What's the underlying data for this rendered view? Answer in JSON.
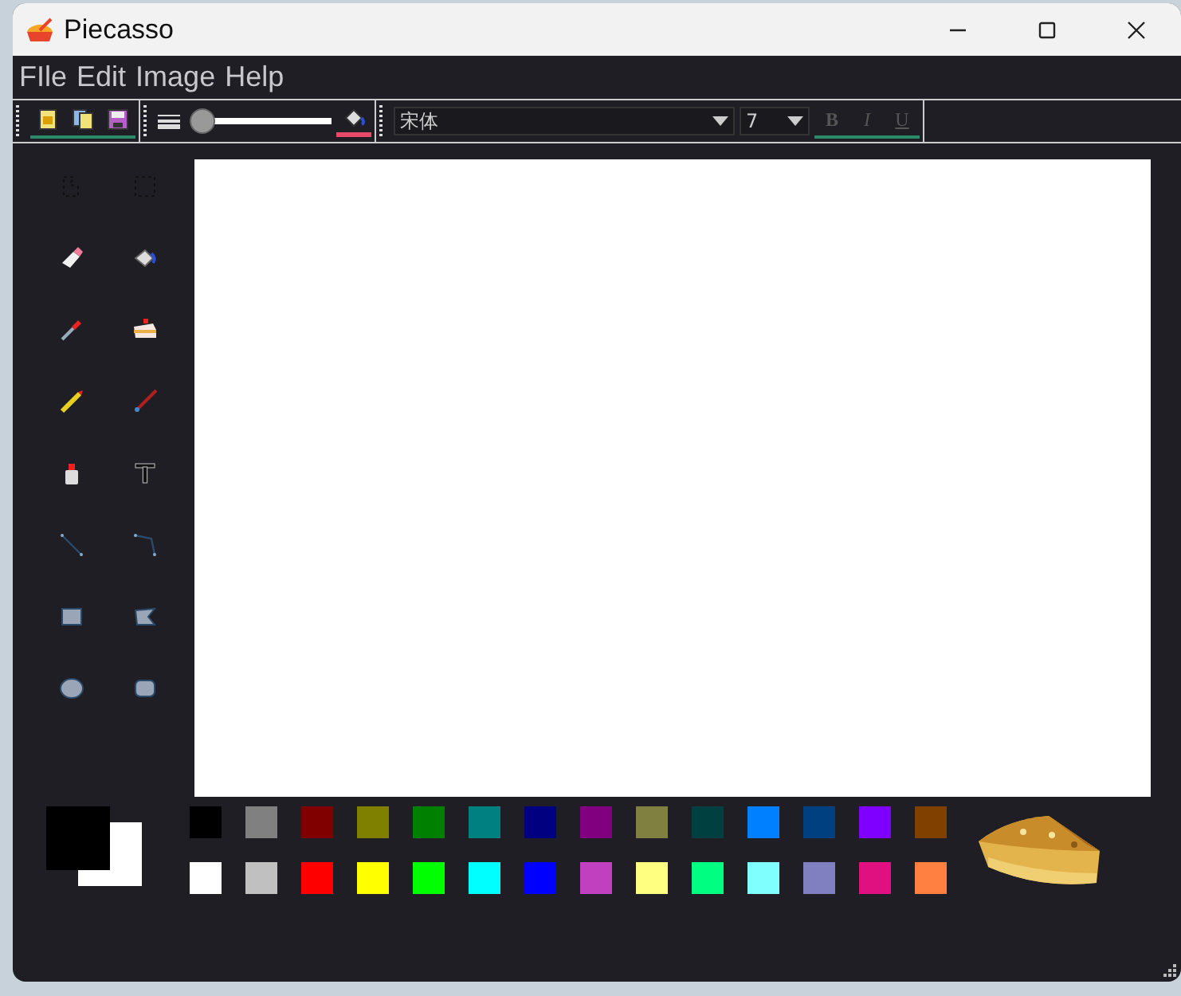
{
  "window": {
    "title": "Piecasso"
  },
  "menu": [
    "FIle",
    "Edit",
    "Image",
    "Help"
  ],
  "toolbar": {
    "file_buttons": [
      {
        "kind": "new"
      },
      {
        "kind": "open"
      },
      {
        "kind": "save"
      }
    ],
    "pen_width": {
      "level": 0.04
    },
    "font": {
      "value": "宋体"
    },
    "size": {
      "value": "7"
    },
    "styles": [
      {
        "label": "B",
        "kind": "bold",
        "disabled": true
      },
      {
        "label": "I",
        "kind": "italic",
        "disabled": true
      },
      {
        "label": "U",
        "kind": "underline",
        "disabled": true
      }
    ]
  },
  "tools": [
    {
      "kind": "free-select"
    },
    {
      "kind": "rect-select"
    },
    {
      "kind": "eraser"
    },
    {
      "kind": "fill"
    },
    {
      "kind": "eyedropper"
    },
    {
      "kind": "stamp"
    },
    {
      "kind": "pencil"
    },
    {
      "kind": "brush"
    },
    {
      "kind": "spray"
    },
    {
      "kind": "text"
    },
    {
      "kind": "line"
    },
    {
      "kind": "polyline"
    },
    {
      "kind": "rect"
    },
    {
      "kind": "polygon"
    },
    {
      "kind": "ellipse"
    },
    {
      "kind": "rounded-rect"
    }
  ],
  "current_colors": {
    "primary": {
      "color": "#000000"
    },
    "secondary": {
      "color": "#ffffff"
    }
  },
  "palette": [
    {
      "color": "#000000"
    },
    {
      "color": "#808080"
    },
    {
      "color": "#800000"
    },
    {
      "color": "#808000"
    },
    {
      "color": "#008000"
    },
    {
      "color": "#008080"
    },
    {
      "color": "#000080"
    },
    {
      "color": "#800080"
    },
    {
      "color": "#808040"
    },
    {
      "color": "#004040"
    },
    {
      "color": "#0080ff"
    },
    {
      "color": "#004080"
    },
    {
      "color": "#8000ff"
    },
    {
      "color": "#804000"
    },
    {
      "color": "#ffffff"
    },
    {
      "color": "#c0c0c0"
    },
    {
      "color": "#ff0000"
    },
    {
      "color": "#ffff00"
    },
    {
      "color": "#00ff00"
    },
    {
      "color": "#00ffff"
    },
    {
      "color": "#0000ff"
    },
    {
      "color": "#c040c0"
    },
    {
      "color": "#ffff80"
    },
    {
      "color": "#00ff80"
    },
    {
      "color": "#80ffff"
    },
    {
      "color": "#8080c0"
    },
    {
      "color": "#e01080"
    },
    {
      "color": "#ff8040"
    }
  ]
}
